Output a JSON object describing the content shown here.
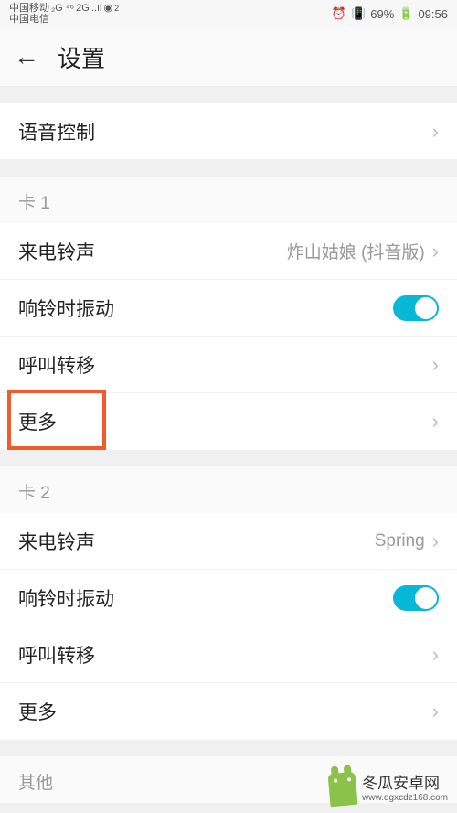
{
  "status_bar": {
    "carrier1": "中国移动",
    "carrier2": "中国电信",
    "net_label": "2G",
    "signal2_sup": "2",
    "battery": "69%",
    "time": "09:56"
  },
  "header": {
    "title": "设置"
  },
  "rows": {
    "voice_control": "语音控制"
  },
  "card1": {
    "header": "卡 1",
    "ringtone_label": "来电铃声",
    "ringtone_value": "炸山姑娘 (抖音版)",
    "vibrate_label": "响铃时振动",
    "forward_label": "呼叫转移",
    "more_label": "更多"
  },
  "card2": {
    "header": "卡 2",
    "ringtone_label": "来电铃声",
    "ringtone_value": "Spring",
    "vibrate_label": "响铃时振动",
    "forward_label": "呼叫转移",
    "more_label": "更多"
  },
  "other": {
    "header": "其他"
  },
  "watermark": {
    "title": "冬瓜安卓网",
    "url": "www.dgxcdz168.com"
  }
}
